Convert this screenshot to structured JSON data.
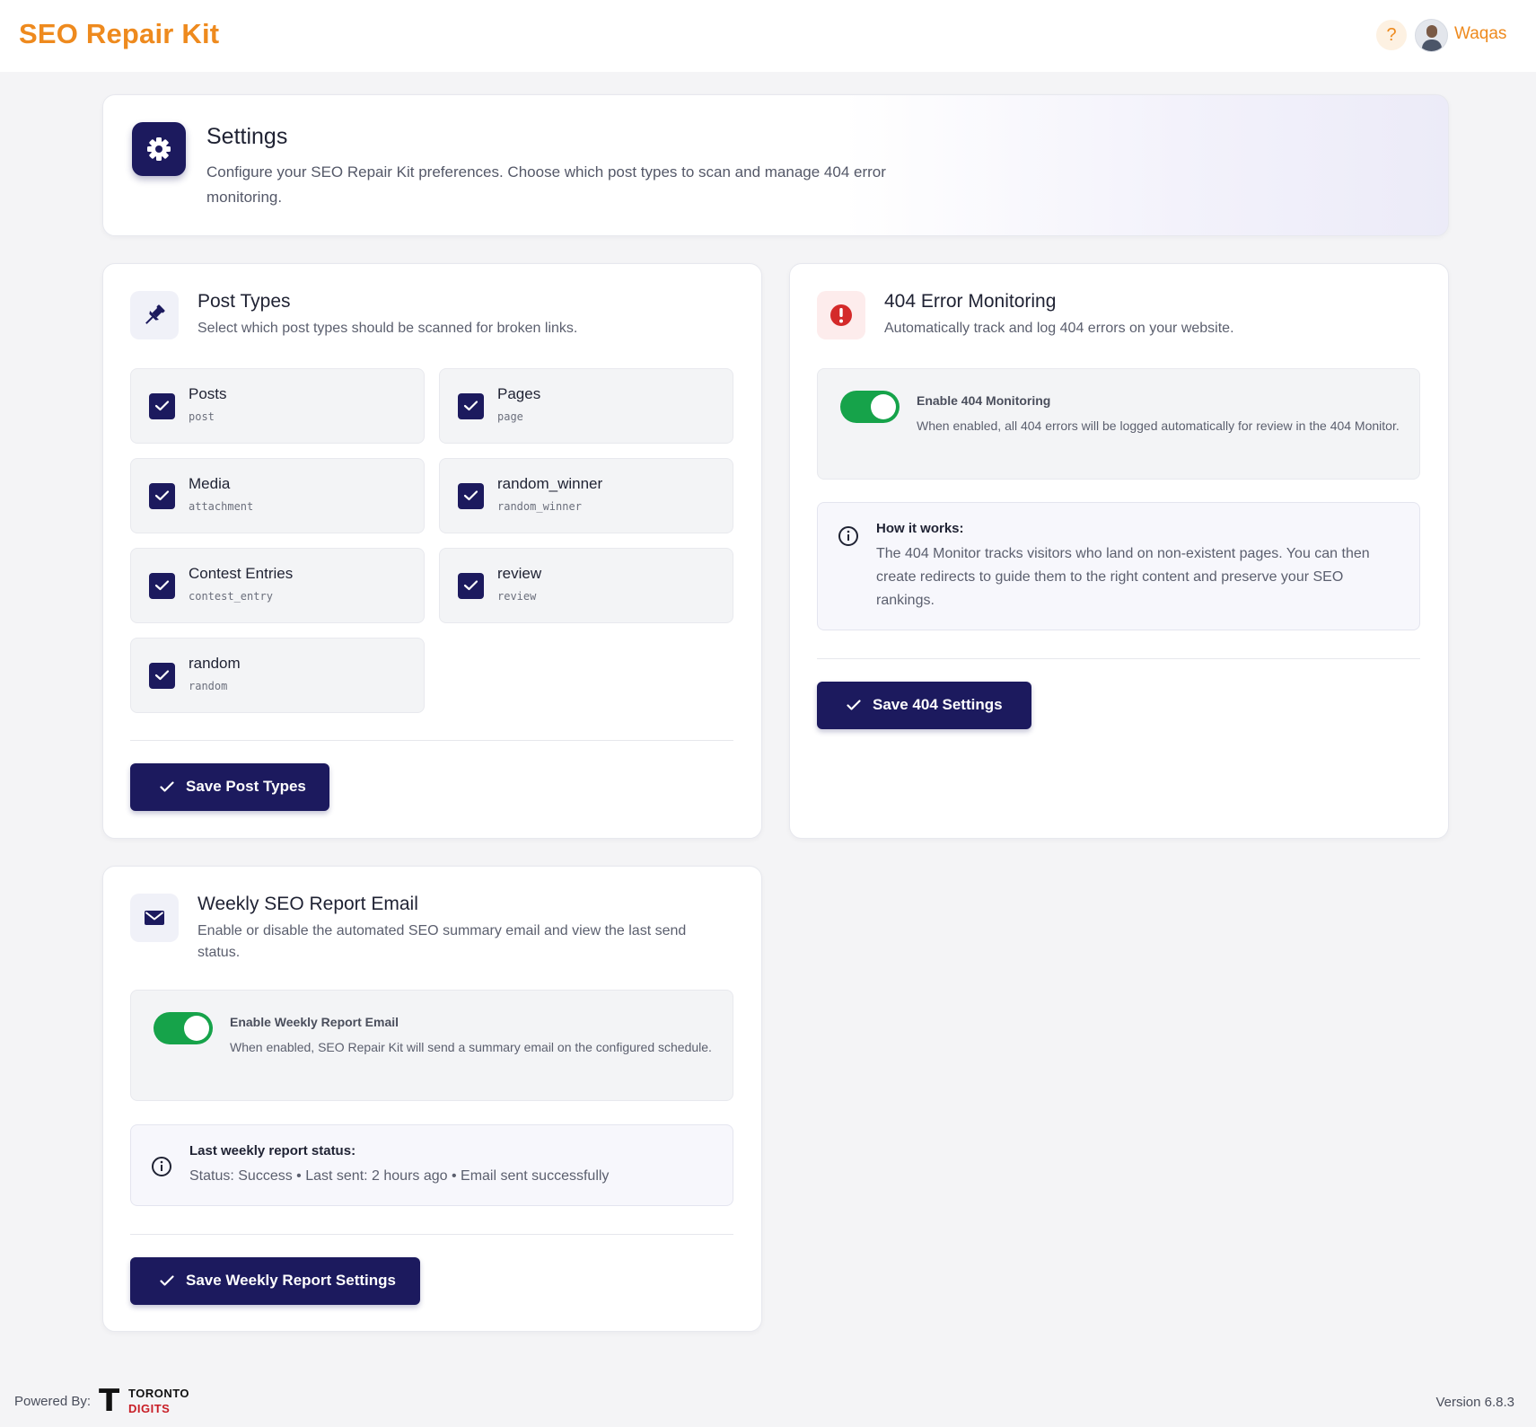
{
  "header": {
    "brand": "SEO Repair Kit",
    "help_label": "?",
    "username": "Waqas",
    "brand_color": "#ee8a1e"
  },
  "hero": {
    "title": "Settings",
    "description": "Configure your SEO Repair Kit preferences. Choose which post types to scan and manage 404 error monitoring.",
    "icon": "gear-icon"
  },
  "post_types": {
    "title": "Post Types",
    "subtitle": "Select which post types should be scanned for broken links.",
    "icon": "pin-icon",
    "items": [
      {
        "label": "Posts",
        "slug": "post",
        "checked": true
      },
      {
        "label": "Pages",
        "slug": "page",
        "checked": true
      },
      {
        "label": "Media",
        "slug": "attachment",
        "checked": true
      },
      {
        "label": "random_winner",
        "slug": "random_winner",
        "checked": true
      },
      {
        "label": "Contest Entries",
        "slug": "contest_entry",
        "checked": true
      },
      {
        "label": "review",
        "slug": "review",
        "checked": true
      },
      {
        "label": "random",
        "slug": "random",
        "checked": true
      }
    ],
    "save_label": "Save Post Types"
  },
  "monitoring": {
    "title": "404 Error Monitoring",
    "subtitle": "Automatically track and log 404 errors on your website.",
    "icon": "alert-icon",
    "toggle_title": "Enable 404 Monitoring",
    "toggle_desc": "When enabled, all 404 errors will be logged automatically for review in the 404 Monitor.",
    "toggle_on": true,
    "info_title": "How it works:",
    "info_text": "The 404 Monitor tracks visitors who land on non-existent pages. You can then create redirects to guide them to the right content and preserve your SEO rankings.",
    "save_label": "Save 404 Settings"
  },
  "weekly": {
    "title": "Weekly SEO Report Email",
    "subtitle": "Enable or disable the automated SEO summary email and view the last send status.",
    "icon": "mail-icon",
    "toggle_title": "Enable Weekly Report Email",
    "toggle_desc": "When enabled, SEO Repair Kit will send a summary email on the configured schedule.",
    "toggle_on": true,
    "status_title": "Last weekly report status:",
    "status_text": "Status: Success • Last sent: 2 hours ago • Email sent successfully",
    "save_label": "Save Weekly Report Settings"
  },
  "footer": {
    "powered_by": "Powered By:",
    "logo_line1": "TORONTO",
    "logo_line2": "DIGITS",
    "version": "Version 6.8.3"
  }
}
